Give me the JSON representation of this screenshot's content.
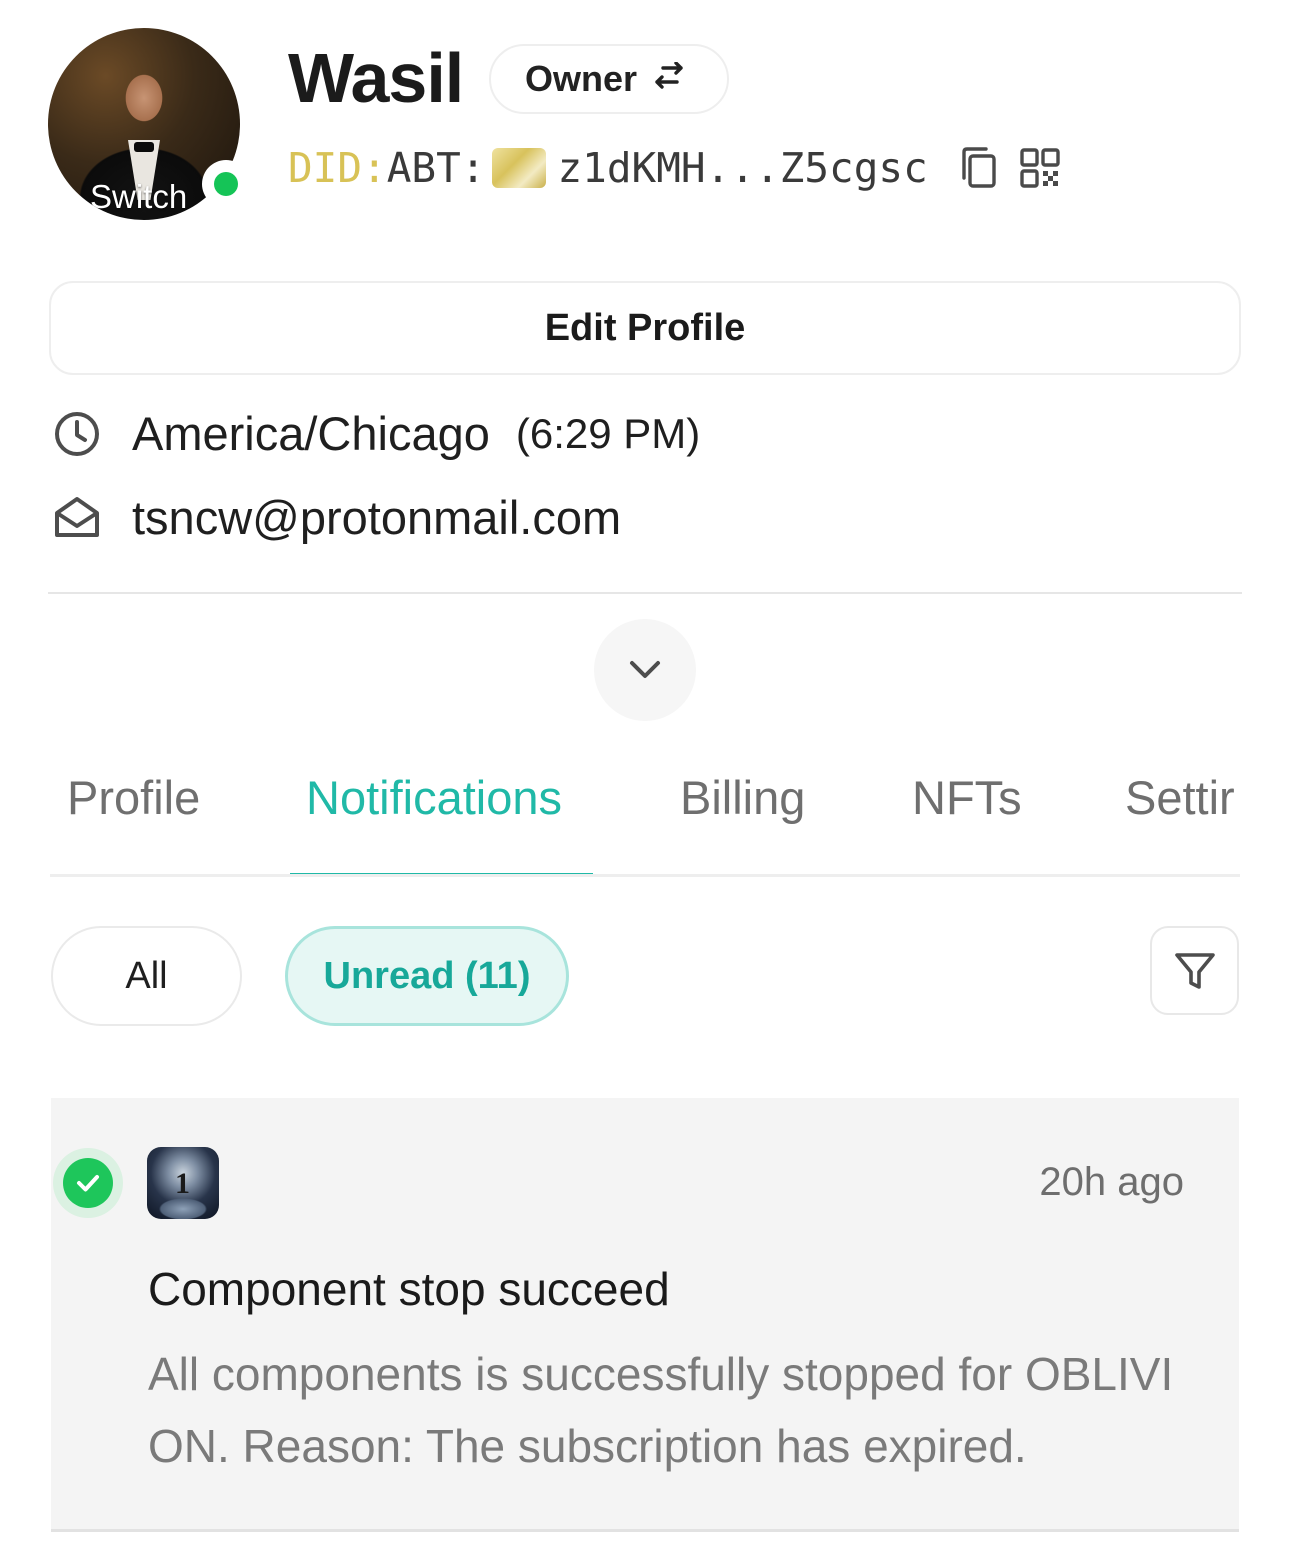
{
  "profile": {
    "avatar_label": "Switch",
    "name": "Wasil",
    "role": "Owner",
    "did_prefix": "DID:",
    "did_scheme": "ABT:",
    "did_short": "z1dKMH...Z5cgsc"
  },
  "actions": {
    "edit_profile": "Edit Profile"
  },
  "info": {
    "timezone": "America/Chicago",
    "local_time": "(6:29 PM)",
    "email": "tsncw@protonmail.com"
  },
  "tabs": [
    {
      "label": "Profile",
      "active": false
    },
    {
      "label": "Notifications",
      "active": true
    },
    {
      "label": "Billing",
      "active": false
    },
    {
      "label": "NFTs",
      "active": false
    },
    {
      "label": "Settir",
      "active": false
    }
  ],
  "filters": {
    "all": "All",
    "unread": "Unread (11)"
  },
  "notification": {
    "status_icon": "check-circle-icon",
    "time": "20h ago",
    "title": "Component stop succeed",
    "body": "All components is successfully stopped for OBLIVION. Reason: The subscription has expired.",
    "app_icon_glyph": "1"
  },
  "colors": {
    "accent": "#20b9a7",
    "online": "#15c457",
    "did_prefix": "#d8c256",
    "success": "#1ec65b"
  }
}
